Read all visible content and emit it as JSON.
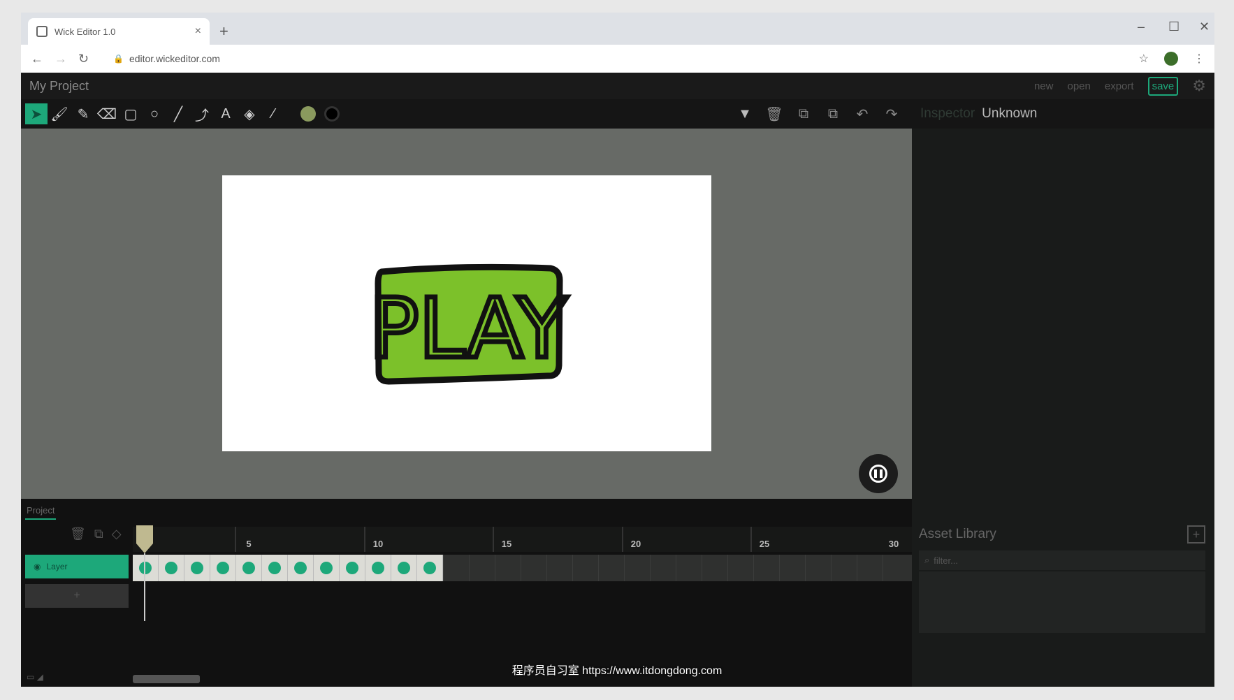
{
  "browser": {
    "tab_title": "Wick Editor 1.0",
    "tab_close": "×",
    "new_tab": "+",
    "url": "editor.wickeditor.com",
    "window_controls": {
      "minimize": "–",
      "maximize": "☐",
      "close": "✕"
    }
  },
  "app": {
    "project_name": "My Project",
    "menu": {
      "new": "new",
      "open": "open",
      "export": "export",
      "save": "save"
    },
    "inspector": {
      "label": "Inspector",
      "value": "Unknown"
    },
    "toolbar": {
      "tools": [
        "cursor-icon",
        "brush-icon",
        "pencil-icon",
        "eraser-icon",
        "rectangle-icon",
        "ellipse-icon",
        "line-icon",
        "path-cursor-icon",
        "text-icon",
        "fill-bucket-icon",
        "eyedropper-icon"
      ],
      "fill_color": "#8a9a5e",
      "stroke_color": "#000000",
      "right_tools": [
        "dropdown-icon",
        "delete-icon",
        "copy-icon",
        "paste-icon",
        "undo-icon",
        "redo-icon"
      ]
    },
    "accent_color": "#1da87a",
    "play_button_color": "#7cc12a",
    "stage_text": "PLAY"
  },
  "asset_library": {
    "title": "Asset Library",
    "add": "+",
    "filter_placeholder": "filter..."
  },
  "timeline": {
    "tab_label": "Project",
    "major_ticks": [
      "5",
      "10",
      "15",
      "20",
      "25",
      "30"
    ],
    "layer_name": "Layer",
    "add_layer": "+",
    "frame_count": 12
  },
  "watermark": "程序员自习室 https://www.itdongdong.com"
}
